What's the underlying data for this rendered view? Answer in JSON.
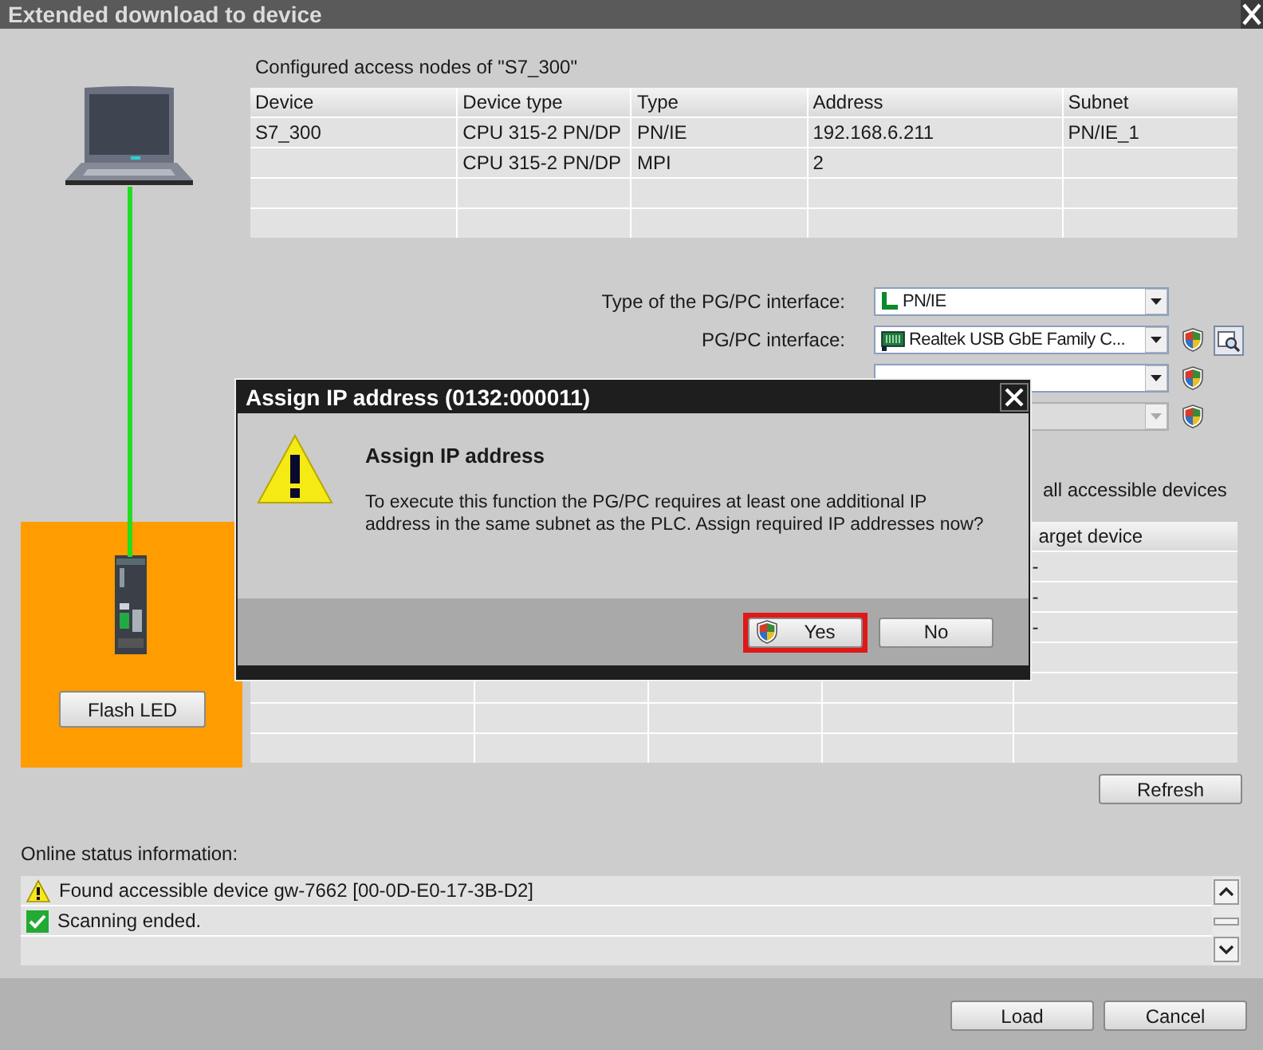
{
  "window": {
    "title": "Extended download to device"
  },
  "access_nodes": {
    "caption": "Configured access nodes of \"S7_300\"",
    "columns": [
      "Device",
      "Device type",
      "Type",
      "Address",
      "Subnet"
    ],
    "rows": [
      [
        "S7_300",
        "CPU 315-2 PN/DP",
        "PN/IE",
        "192.168.6.211",
        "PN/IE_1"
      ],
      [
        "",
        "CPU 315-2 PN/DP",
        "MPI",
        "2",
        ""
      ],
      [
        "",
        "",
        "",
        "",
        ""
      ],
      [
        "",
        "",
        "",
        "",
        ""
      ]
    ]
  },
  "interface_settings": [
    {
      "label": "Type of the PG/PC interface:",
      "value": "PN/IE",
      "kind": "network",
      "disabled": false,
      "shield": false,
      "search": false
    },
    {
      "label": "PG/PC interface:",
      "value": "Realtek USB GbE Family C...",
      "kind": "adapter",
      "disabled": false,
      "shield": true,
      "search": true
    },
    {
      "kind": "empty",
      "disabled": false,
      "shield": true,
      "search": false
    },
    {
      "kind": "empty",
      "disabled": true,
      "shield": true,
      "search": false
    }
  ],
  "target_device": {
    "flash_button": "Flash LED"
  },
  "show_all_label": "all accessible devices",
  "accessible_devices": {
    "column_5": "arget device",
    "rows": [
      [
        "-"
      ],
      [
        "-"
      ],
      [
        "-"
      ],
      [
        ""
      ],
      [
        ""
      ],
      [
        ""
      ],
      [
        ""
      ]
    ]
  },
  "refresh_button": "Refresh",
  "online_status": {
    "label": "Online status information:",
    "entries": [
      {
        "kind": "warning",
        "text": "Found accessible device gw-7662 [00-0D-E0-17-3B-D2]"
      },
      {
        "kind": "success",
        "text": "Scanning ended."
      },
      {
        "kind": "empty"
      }
    ]
  },
  "footer_buttons": [
    "Load",
    "Cancel"
  ],
  "dialog": {
    "title": "Assign IP address (0132:000011)",
    "heading": "Assign IP address",
    "message": "To execute this function the PG/PC requires at least one additional IP address in the same subnet as the PLC. Assign required IP addresses now?",
    "buttons": [
      {
        "label": "Yes",
        "kind": "elevated",
        "highlighted": true
      },
      {
        "label": "No",
        "kind": "plain",
        "highlighted": false
      }
    ]
  }
}
